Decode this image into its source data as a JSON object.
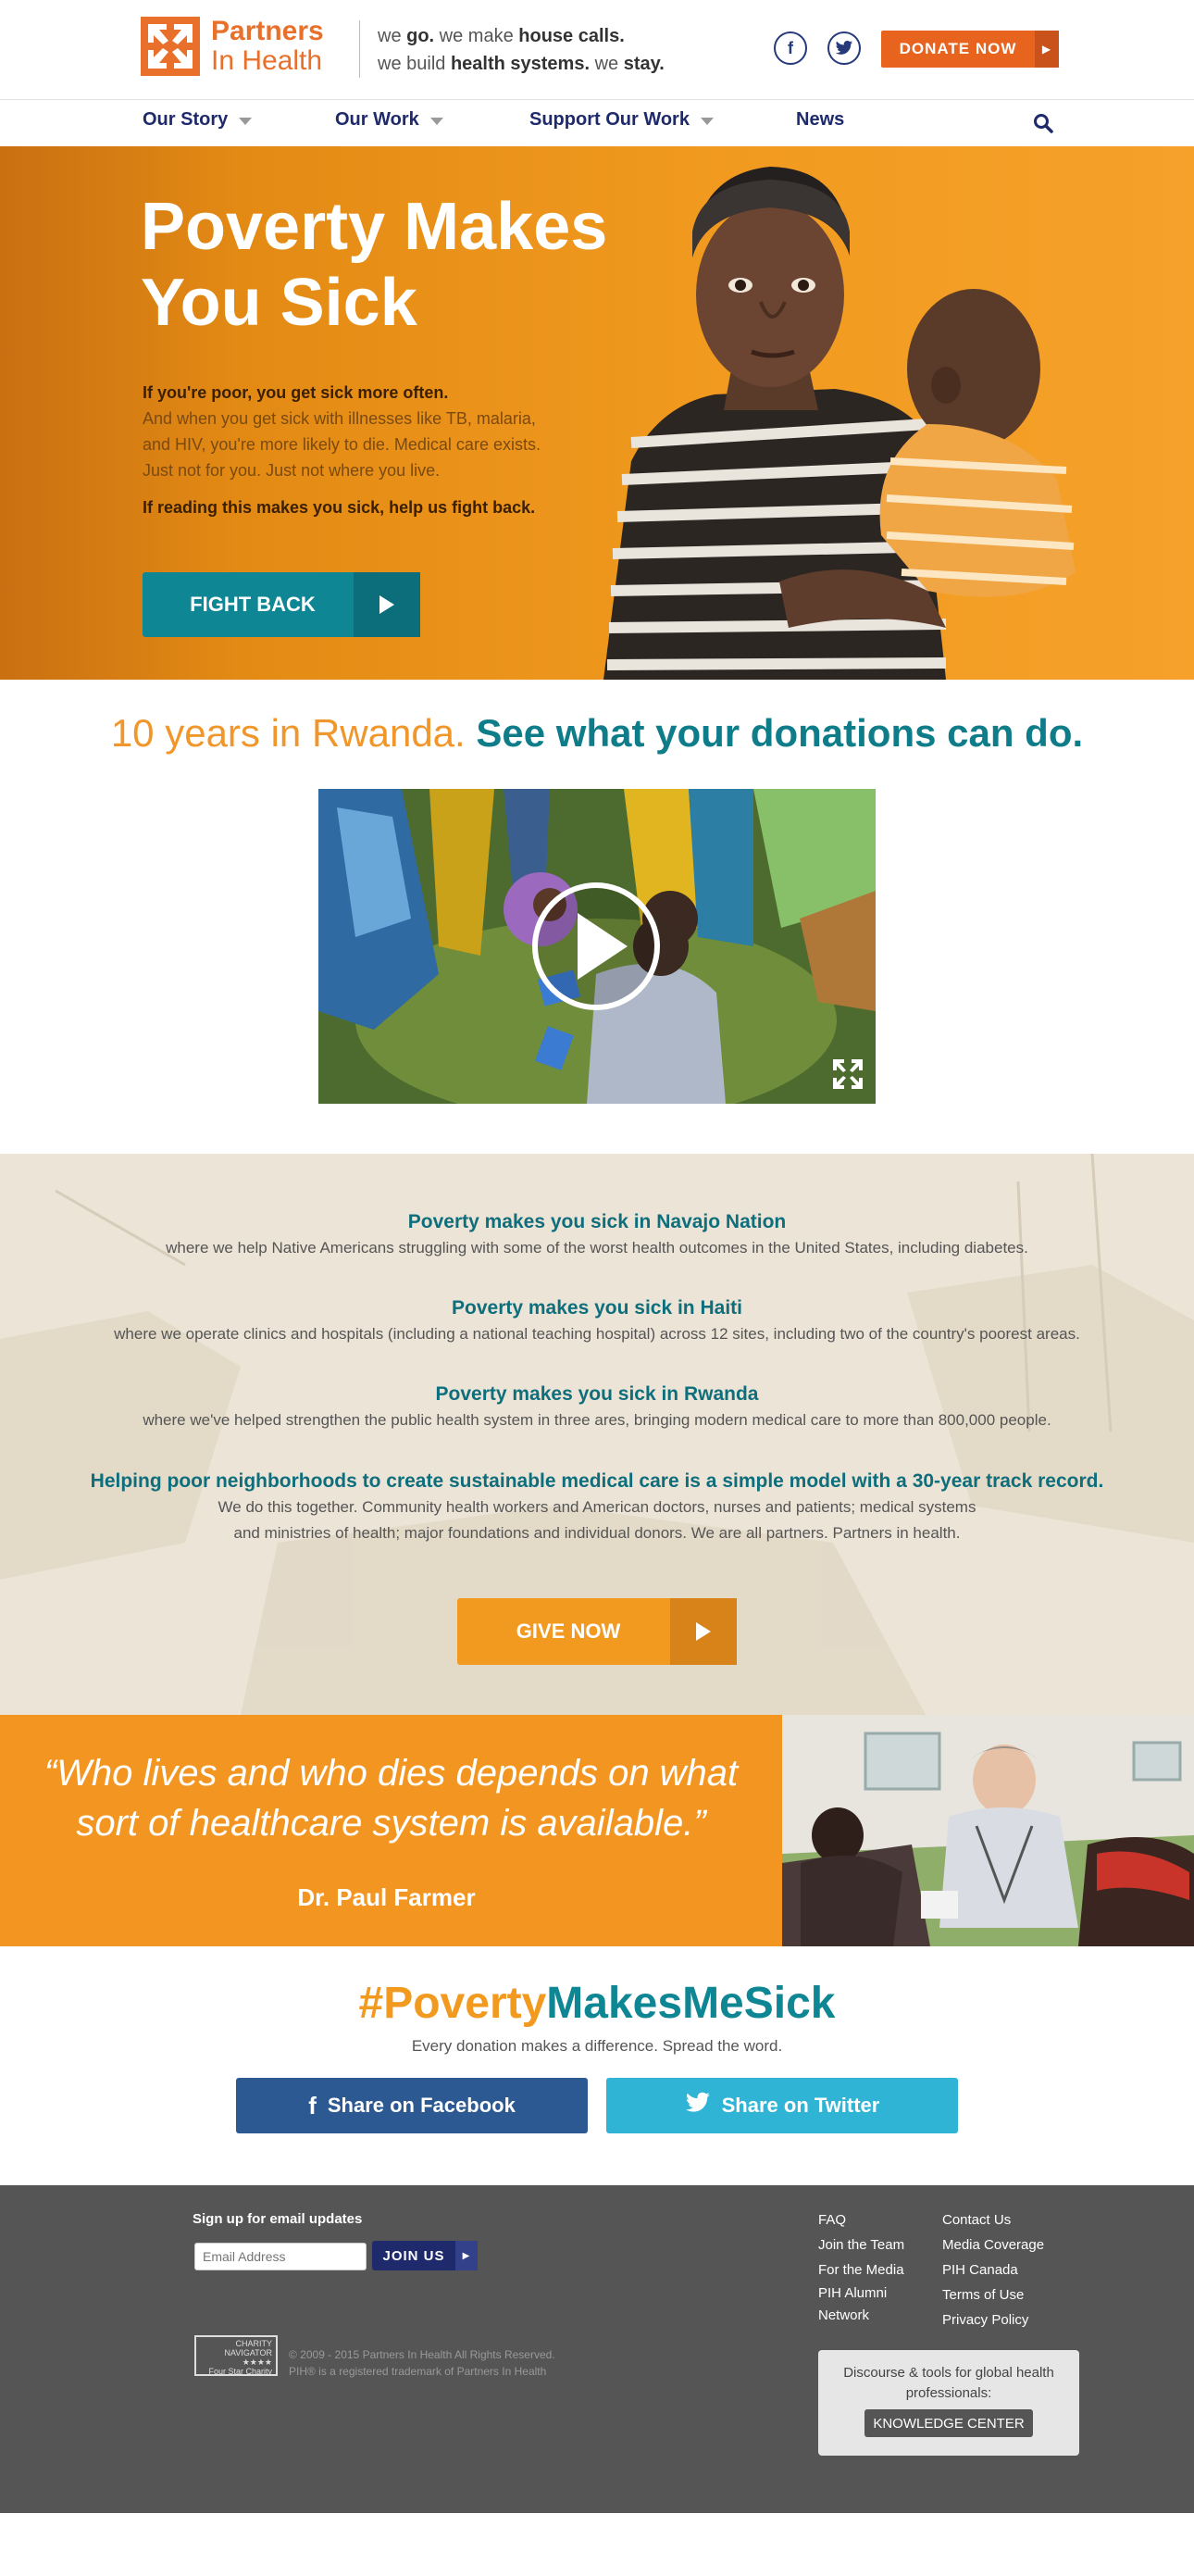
{
  "header": {
    "logo_line1": "Partners",
    "logo_line2": "In Health",
    "tagline": {
      "l1_a": "we ",
      "l1_b": "go.",
      "l1_c": " we make ",
      "l1_d": "house calls.",
      "l2_a": "we build ",
      "l2_b": "health systems.",
      "l2_c": " we ",
      "l2_d": "stay."
    },
    "facebook_glyph": "f",
    "donate_label": "DONATE NOW"
  },
  "nav": {
    "items": [
      {
        "label": "Our Story"
      },
      {
        "label": "Our Work"
      },
      {
        "label": "Support Our Work"
      },
      {
        "label": "News"
      }
    ]
  },
  "hero": {
    "title_line1": "Poverty Makes",
    "title_line2": "You Sick",
    "p1_bold": "If you're poor, you get sick more often.",
    "p1_rest": "And when you get sick with illnesses like TB, malaria, and HIV, you're more likely to die. Medical care exists. Just not for you. Just not where you live.",
    "p2": "If reading this makes you sick, help us fight back.",
    "cta": "FIGHT BACK"
  },
  "rwanda": {
    "lead": "10 years in Rwanda.",
    "bold": "See what your donations can do."
  },
  "sick_in": [
    {
      "heading": "Poverty makes you sick in Navajo Nation",
      "text": "where we help Native Americans struggling with some of the worst health outcomes in the United States, including diabetes."
    },
    {
      "heading": "Poverty makes you sick in Haiti",
      "text": "where we operate clinics and hospitals (including a national teaching hospital) across 12 sites, including two of the country's poorest areas."
    },
    {
      "heading": "Poverty makes you sick in Rwanda",
      "text": "where we've helped strengthen the public health system in three ares, bringing modern medical care to more than 800,000 people."
    },
    {
      "heading": "Helping poor neighborhoods to create sustainable medical care is a simple model with a 30-year track record.",
      "text": "We do this together. Community health workers and American doctors, nurses and patients; medical systems",
      "text2": "and ministries of health; major foundations and individual donors. We are all partners. Partners in health."
    }
  ],
  "give_now": "GIVE NOW",
  "quote": {
    "line1": "“Who lives and who dies depends on what",
    "line2": "sort of healthcare system is available.”",
    "author": "Dr. Paul Farmer"
  },
  "hashtag": {
    "part1": "#Poverty",
    "part2": "MakesMeSick",
    "sub": "Every donation makes a difference. Spread the word."
  },
  "share": {
    "facebook": "Share on Facebook",
    "twitter": "Share on Twitter"
  },
  "footer": {
    "signup": "Sign up for email updates",
    "email_placeholder": "Email Address",
    "join": "JOIN US",
    "badge_line1": "CHARITY",
    "badge_line2": "NAVIGATOR",
    "badge_stars": "★★★★",
    "badge_line3": "Four Star Charity",
    "copyright": "© 2009 - 2015 Partners In Health All Rights Reserved.",
    "trademark": "PIH® is a registered trademark of Partners In Health",
    "links_col1": [
      "FAQ",
      "Join the Team",
      "For the Media",
      "PIH Alumni Network"
    ],
    "links_col2": [
      "Contact Us",
      "Media Coverage",
      "PIH Canada",
      "Terms of Use",
      "Privacy Policy"
    ],
    "kc_text": "Discourse & tools for global health professionals:",
    "kc_button": "KNOWLEDGE CENTER"
  },
  "colors": {
    "orange": "#f19a1f",
    "teal": "#0f8694",
    "navy": "#1e2a6b",
    "donate": "#e8641e"
  }
}
